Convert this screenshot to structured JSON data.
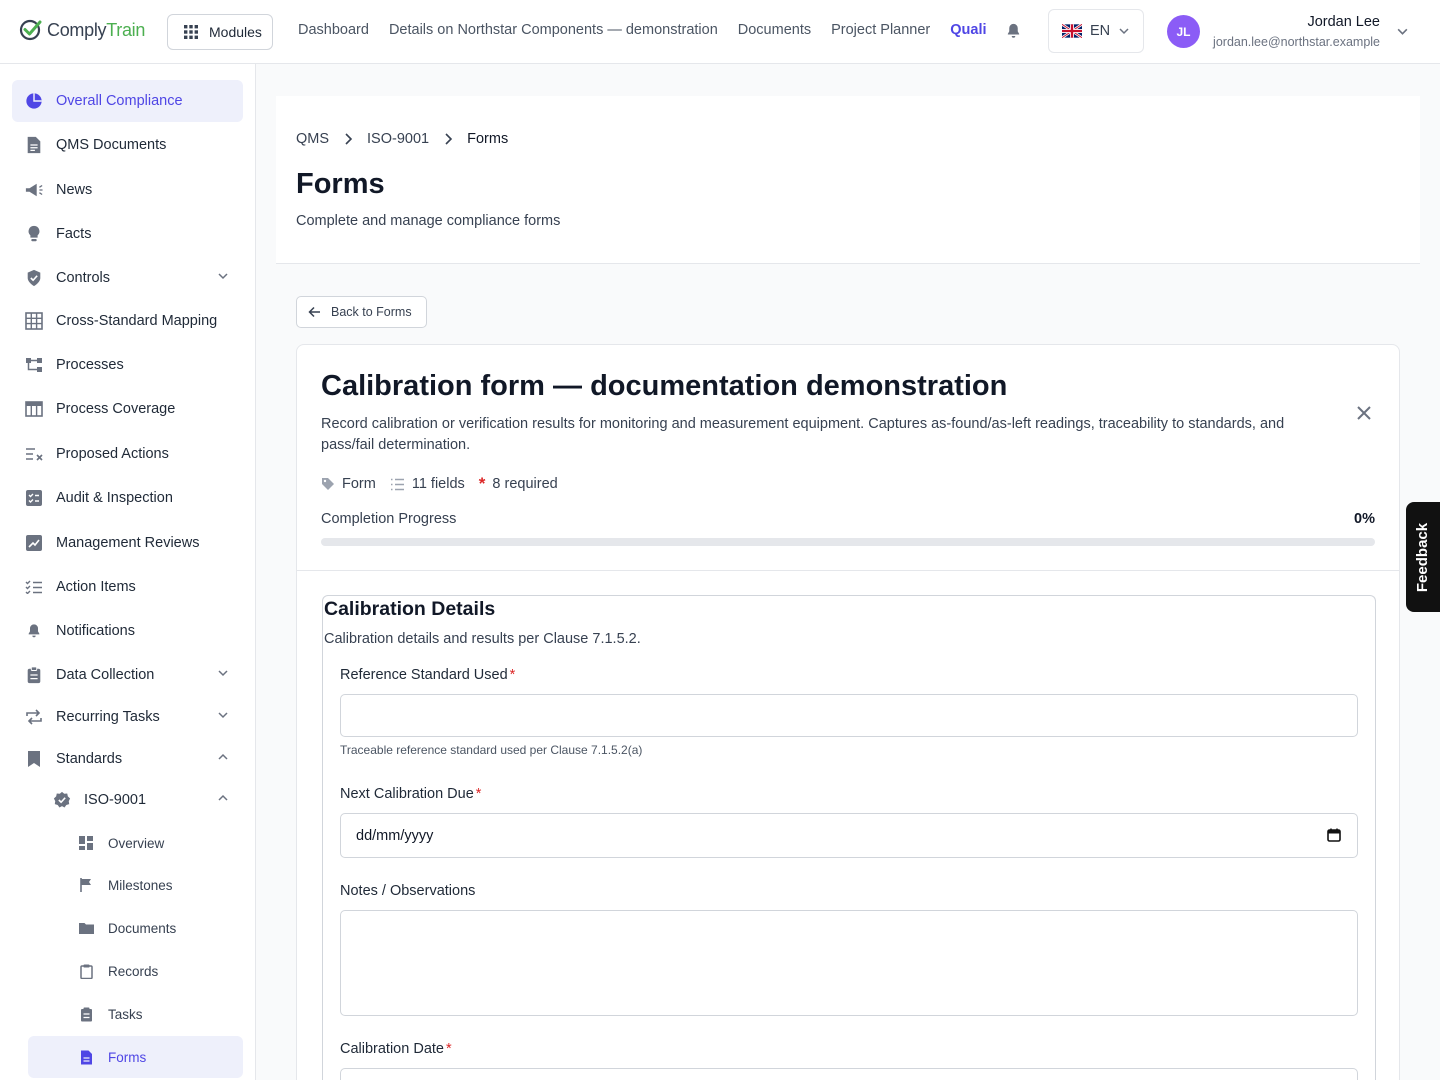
{
  "brand": {
    "name_part1": "Comply",
    "name_part2": "Train"
  },
  "topbar": {
    "modules_label": "Modules",
    "nav": [
      "Dashboard",
      "Details on Northstar Components — demonstration",
      "Documents",
      "Project Planner",
      "Quali"
    ],
    "language": "EN",
    "user_initials": "JL",
    "user_name": "Jordan Lee",
    "user_email": "jordan.lee@northstar.example"
  },
  "sidebar": {
    "items": [
      {
        "label": "Overall Compliance",
        "icon": "pie-chart-icon"
      },
      {
        "label": "QMS Documents",
        "icon": "document-icon"
      },
      {
        "label": "News",
        "icon": "megaphone-icon"
      },
      {
        "label": "Facts",
        "icon": "lightbulb-icon"
      },
      {
        "label": "Controls",
        "icon": "shield-check-icon"
      },
      {
        "label": "Cross-Standard Mapping",
        "icon": "grid-icon"
      },
      {
        "label": "Processes",
        "icon": "flow-icon"
      },
      {
        "label": "Process Coverage",
        "icon": "table-icon"
      },
      {
        "label": "Proposed Actions",
        "icon": "list-x-icon"
      },
      {
        "label": "Audit & Inspection",
        "icon": "checklist-box-icon"
      },
      {
        "label": "Management Reviews",
        "icon": "chart-review-icon"
      },
      {
        "label": "Action Items",
        "icon": "list-check-icon"
      },
      {
        "label": "Notifications",
        "icon": "bell-icon"
      },
      {
        "label": "Data Collection",
        "icon": "clipboard-icon"
      },
      {
        "label": "Recurring Tasks",
        "icon": "repeat-icon"
      },
      {
        "label": "Standards",
        "icon": "bookmark-icon"
      },
      {
        "label": "ISO-9001",
        "icon": "badge-check-icon"
      },
      {
        "label": "Overview",
        "icon": "dashboard-icon"
      },
      {
        "label": "Milestones",
        "icon": "flag-icon"
      },
      {
        "label": "Documents",
        "icon": "folder-icon"
      },
      {
        "label": "Records",
        "icon": "clipboard-record-icon"
      },
      {
        "label": "Tasks",
        "icon": "task-icon"
      },
      {
        "label": "Forms",
        "icon": "form-icon"
      }
    ]
  },
  "header": {
    "breadcrumb": [
      "QMS",
      "ISO-9001",
      "Forms"
    ],
    "title": "Forms",
    "subtitle": "Complete and manage compliance forms"
  },
  "back_label": "Back to Forms",
  "form": {
    "title": "Calibration form — documentation demonstration",
    "description": "Record calibration or verification results for monitoring and measurement equipment. Captures as-found/as-left readings, traceability to standards, and pass/fail determination.",
    "meta_type": "Form",
    "meta_fields": "11 fields",
    "meta_required": "8 required",
    "progress_label": "Completion Progress",
    "progress_value": "0%",
    "progress_fraction": 0,
    "section": {
      "title": "Calibration Details",
      "subtitle": "Calibration details and results per Clause 7.1.5.2.",
      "fields": [
        {
          "label": "Reference Standard Used",
          "required": "*",
          "value": "",
          "hint": "Traceable reference standard used per Clause 7.1.5.2(a)"
        },
        {
          "label": "Next Calibration Due",
          "required": "*",
          "placeholder": "dd/mm/yyyy"
        },
        {
          "label": "Notes / Observations",
          "value": ""
        },
        {
          "label": "Calibration Date",
          "required": "*"
        }
      ]
    }
  },
  "feedback_label": "Feedback",
  "colors": {
    "accent": "#4f46e5",
    "required": "#dc2626",
    "avatar": "#8b5cf6",
    "brand_green": "#4caf50"
  }
}
